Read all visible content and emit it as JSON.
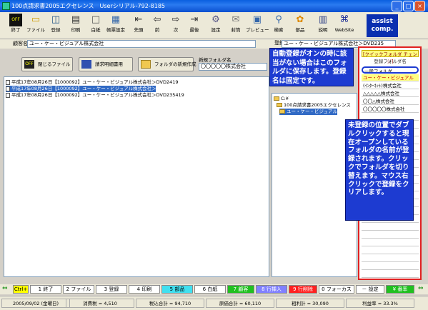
{
  "window": {
    "title": "100点請求書2005エクセレンス　Userシリアル-792-8185"
  },
  "toolbar": [
    {
      "label": "終了",
      "icon": "off-icon",
      "color": "#000000"
    },
    {
      "label": "ファイル",
      "icon": "folder-icon"
    },
    {
      "label": "登録",
      "icon": "save-icon"
    },
    {
      "label": "印刷",
      "icon": "printer-icon"
    },
    {
      "label": "白紙",
      "icon": "blank-page-icon"
    },
    {
      "label": "帳票設定",
      "icon": "form-settings-icon"
    },
    {
      "label": "先頭",
      "icon": "first-arrow-icon"
    },
    {
      "label": "前",
      "icon": "prev-arrow-icon"
    },
    {
      "label": "次",
      "icon": "next-arrow-icon"
    },
    {
      "label": "最後",
      "icon": "last-arrow-icon"
    },
    {
      "label": "設定",
      "icon": "gear-icon"
    },
    {
      "label": "封筒",
      "icon": "envelope-icon"
    },
    {
      "label": "プレビュー",
      "icon": "preview-icon"
    },
    {
      "label": "検索",
      "icon": "search-icon"
    },
    {
      "label": "部品",
      "icon": "parts-icon"
    },
    {
      "label": "説明",
      "icon": "help-book-icon"
    },
    {
      "label": "WebSite",
      "icon": "web-icon"
    }
  ],
  "assist": {
    "line1": "assist",
    "line2": "comp."
  },
  "customer": {
    "label": "顧客名",
    "value": "ユー・ケー・ビジュアル株式会社"
  },
  "registered": {
    "label": "登録",
    "value": "ユー・ケー・ビジュアル株式会社＞DVD235"
  },
  "buttons": {
    "close_file": "閉じるファイル",
    "detail": "請求明細書用",
    "new_folder": "フォルダの新規作成",
    "new_folder_name_label": "新規フォルダ名",
    "new_folder_name_value": "〇〇〇〇〇株式会社"
  },
  "files": [
    "平成17年08月26日【1000092】ユー・ケー・ビジュアル株式会社＞DVD2419",
    "平成17年08月26日【1000092】ユー・ケー・ビジュアル株式会社＞DVD2419",
    "平成17年08月26日【1000092】ユー・ケー・ビジュアル株式会社＞DVD235419"
  ],
  "tree": [
    "C:¥",
    "100点請求書2005エクセレンス",
    "ユー・ケー・ビジュアル"
  ],
  "right_panel": {
    "header": "[クイックフォルダ チェンジ]",
    "sub": "登録フォルダ名",
    "items": [
      "一般フォルダ",
      "ユー・ケー・ビジュアル",
      "(ｲﾝﾀｰﾈｯﾄ)株式会社",
      "△△△△△株式会社",
      "〇〇△株式会社",
      "〇〇〇〇〇株式会社"
    ]
  },
  "notes": {
    "top": "自動登録がオンの時に該当がない場合はこのフォルダに保存します。登録名は固定です。",
    "right": "未登録の位置でダブルクリックすると現在オープンしているフォルダの名前が登録されます。クリックでフォルダを切り替えます。マウス右クリックで登録をクリアします。"
  },
  "fkeys": [
    {
      "label": "Ctrl+",
      "bg": "#ffff00"
    },
    {
      "label": "1 終了",
      "bg": "#ffffff"
    },
    {
      "label": "2 ファイル",
      "bg": "#ffffff"
    },
    {
      "label": "3 登録",
      "bg": "#ffffff"
    },
    {
      "label": "4 印刷",
      "bg": "#ffffff"
    },
    {
      "label": "5 部品",
      "bg": "#40e0f0"
    },
    {
      "label": "6 白紙",
      "bg": "#ffffff"
    },
    {
      "label": "7 顧客",
      "bg": "#20c020"
    },
    {
      "label": "8 行挿入",
      "bg": "#8080ff"
    },
    {
      "label": "9 行削除",
      "bg": "#ff2020"
    },
    {
      "label": "0 フォーカス",
      "bg": "#ffffff"
    },
    {
      "label": "－ 設定",
      "bg": "#ffffff"
    },
    {
      "label": "¥ 番率",
      "bg": "#20c020"
    }
  ],
  "status": [
    "2005/09/02 (金曜日)",
    "消費税 = 4,510",
    "税込合計 = 94,710",
    "原価合計 = 60,110",
    "粗利計 = 30,090",
    "利益率 = 33.3%"
  ]
}
